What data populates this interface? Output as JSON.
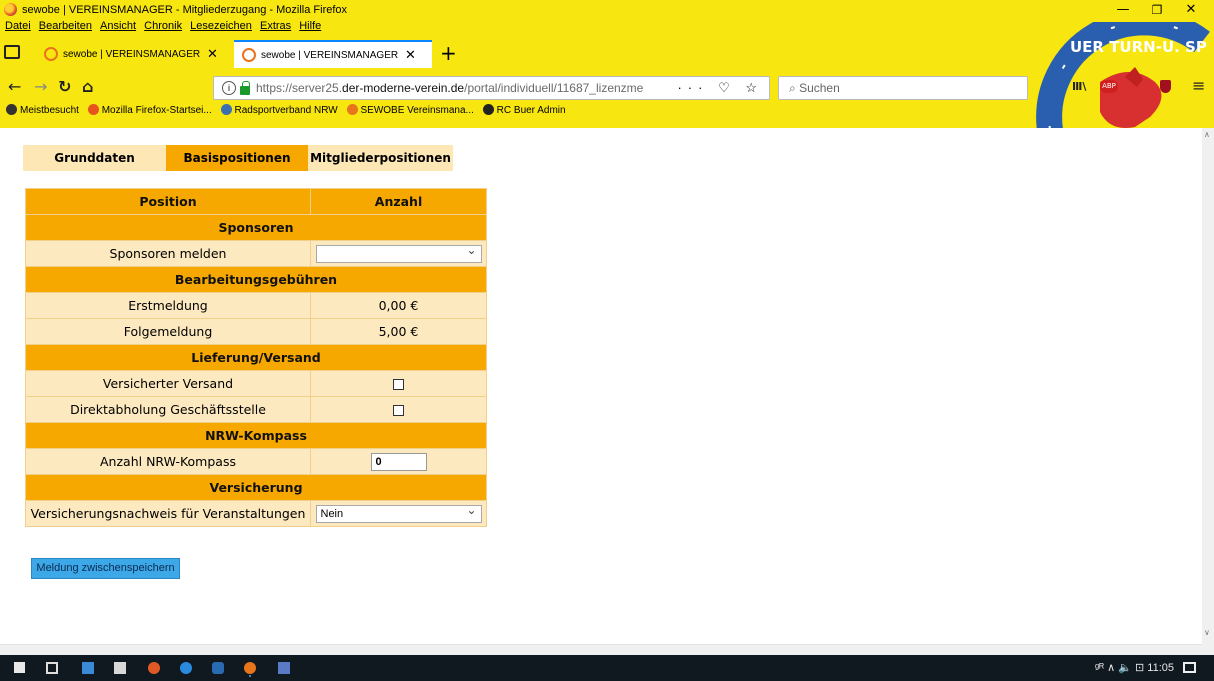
{
  "window": {
    "title": "sewobe | VEREINSMANAGER - Mitgliederzugang - Mozilla Firefox",
    "minimize": "—",
    "maximize": "❐",
    "close": "✕"
  },
  "menu": [
    "Datei",
    "Bearbeiten",
    "Ansicht",
    "Chronik",
    "Lesezeichen",
    "Extras",
    "Hilfe"
  ],
  "tabs": [
    {
      "label": "sewobe | VEREINSMANAGER - M",
      "close": "✕"
    },
    {
      "label": "sewobe | VEREINSMANAGER - M",
      "close": "✕"
    }
  ],
  "newtab": "+",
  "nav": {
    "back": "←",
    "forward": "→",
    "reload": "↻",
    "home": "⌂"
  },
  "url": {
    "prefix": "https://server25.",
    "domain": "der-moderne-verein.de",
    "path": "/portal/individuell/11687_lizenzme",
    "actions": "··· ♡ ☆"
  },
  "search_placeholder": "Suchen",
  "bookmarks": [
    {
      "label": "Meistbesucht",
      "color": "#333333"
    },
    {
      "label": "Mozilla Firefox-Startsei...",
      "color": "#e8521e"
    },
    {
      "label": "Radsportverband NRW",
      "color": "#3a6fb0"
    },
    {
      "label": "SEWOBE Vereinsmana...",
      "color": "#e8741c"
    },
    {
      "label": "RC Buer Admin",
      "color": "#222222"
    }
  ],
  "emblem_text": "AUNSCHWEIGER TURN-U. SPORTVER",
  "subtabs": [
    "Grunddaten",
    "Basispositionen",
    "Mitgliederpositionen"
  ],
  "active_subtab": "Basispositionen",
  "table": {
    "col_position": "Position",
    "col_anzahl": "Anzahl",
    "sections": {
      "sponsoren": "Sponsoren",
      "gebuehren": "Bearbeitungsgebühren",
      "lieferung": "Lieferung/Versand",
      "kompass": "NRW-Kompass",
      "versicherung": "Versicherung"
    },
    "rows": {
      "sponsoren_melden": {
        "label": "Sponsoren melden",
        "value": ""
      },
      "erstmeldung": {
        "label": "Erstmeldung",
        "value": "0,00 €"
      },
      "folgemeldung": {
        "label": "Folgemeldung",
        "value": "5,00 €"
      },
      "versand": {
        "label": "Versicherter Versand",
        "checked": false
      },
      "abholung": {
        "label": "Direktabholung Geschäftsstelle",
        "checked": false
      },
      "kompass_anzahl": {
        "label": "Anzahl NRW-Kompass",
        "value": "0"
      },
      "versicherungsnachweis": {
        "label": "Versicherungsnachweis für Veranstaltungen",
        "value": "Nein"
      }
    }
  },
  "save_button": "Meldung zwischenspeichern",
  "taskbar": {
    "tray": "ᵍᴿ  ∧  🔈 ⊡  11:05"
  },
  "colors": {
    "chrome": "#f8e610",
    "accent": "#f6a800",
    "row": "#fde9bf",
    "button": "#3da8e8"
  }
}
